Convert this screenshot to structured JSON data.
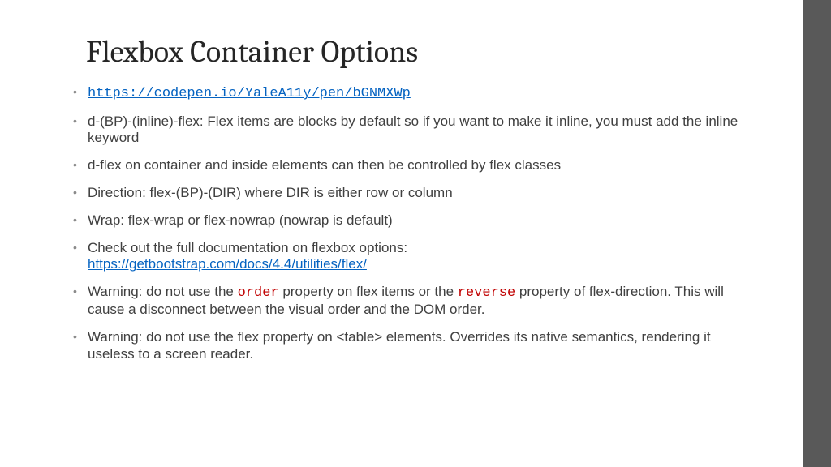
{
  "slide": {
    "title": "Flexbox Container Options",
    "bullets": [
      {
        "type": "link",
        "href": "https://codepen.io/YaleA11y/pen/bGNMXWp",
        "text": "https://codepen.io/YaleA11y/pen/bGNMXWp"
      },
      {
        "type": "text",
        "text": "d-(BP)-(inline)-flex: Flex items are blocks by default so if you want to make it inline, you must add the inline keyword"
      },
      {
        "type": "text",
        "text": "d-flex on container and inside elements can then be controlled by flex classes"
      },
      {
        "type": "text",
        "text": "Direction: flex-(BP)-(DIR) where DIR is either row or column"
      },
      {
        "type": "text",
        "text": "Wrap: flex-wrap or flex-nowrap (nowrap is default)"
      },
      {
        "type": "text_with_link",
        "pre": "Check out the full documentation on flexbox options: ",
        "href": "https://getbootstrap.com/docs/4.4/utilities/flex/",
        "link_text": "https://getbootstrap.com/docs/4.4/utilities/flex/"
      },
      {
        "type": "warning1",
        "p1": "Warning: do not use the ",
        "c1": "order",
        "p2": " property on flex items or the ",
        "c2": "reverse",
        "p3": " property of flex-direction. This will cause a disconnect between the visual order and the DOM order."
      },
      {
        "type": "text",
        "text": "Warning: do not use the flex property on <table> elements. Overrides its native semantics, rendering it useless to a screen reader."
      }
    ]
  }
}
